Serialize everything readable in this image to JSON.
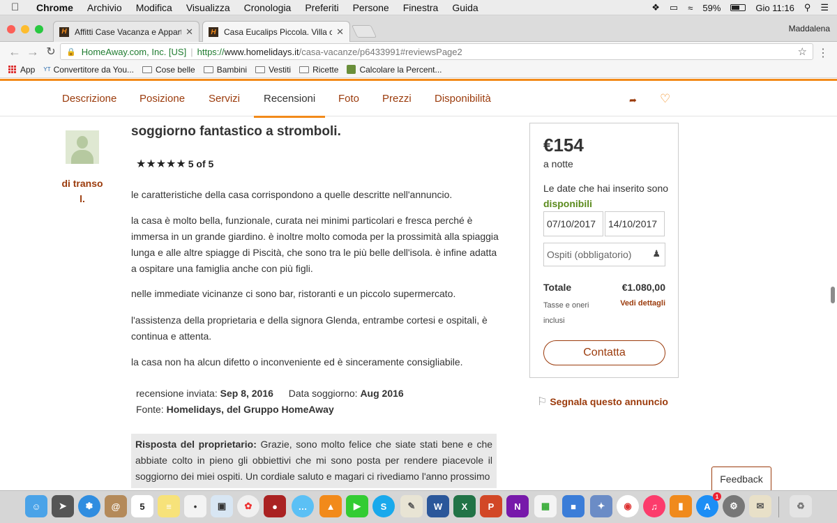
{
  "menubar": {
    "app": "Chrome",
    "items": [
      "Archivio",
      "Modifica",
      "Visualizza",
      "Cronologia",
      "Preferiti",
      "Persone",
      "Finestra",
      "Guida"
    ],
    "battery_percent": "59%",
    "battery_level": 0.59,
    "clock": "Gio 11:16"
  },
  "browser": {
    "tabs": [
      {
        "title": "Affitti Case Vacanza e Apparta"
      },
      {
        "title": "Casa Eucalips Piccola. Villa co"
      }
    ],
    "profile": "Maddalena",
    "address": {
      "secure_label": "HomeAway.com, Inc. [US]",
      "scheme": "https://",
      "host": "www.homelidays.it",
      "path": "/casa-vacanze/p6433991#reviewsPage2"
    },
    "bookmarks": [
      "App",
      "Convertitore da You...",
      "Cose belle",
      "Bambini",
      "Vestiti",
      "Ricette",
      "Calcolare la Percent..."
    ]
  },
  "page_nav": {
    "items": [
      "Descrizione",
      "Posizione",
      "Servizi",
      "Recensioni",
      "Foto",
      "Prezzi",
      "Disponibilità"
    ],
    "active": "Recensioni"
  },
  "review": {
    "reviewer": "di transo l.",
    "title": "soggiorno fantastico a stromboli.",
    "stars": "★★★★★",
    "rating": "5 of 5",
    "paragraphs": [
      "le caratteristiche della casa corrispondono a quelle descritte nell'annuncio.",
      "la casa è molto bella, funzionale, curata nei minimi particolari e fresca perché è immersa in un grande giardino. è inoltre molto comoda per la prossimità alla spiaggia lunga e alle altre spiagge di Piscità, che sono tra le più belle dell'isola. è infine adatta a ospitare una famiglia anche con più figli.",
      "nelle immediate vicinanze ci sono bar, ristoranti e un piccolo supermercato.",
      "l'assistenza della proprietaria e della signora Glenda, entrambe cortesi e ospitali, è continua e attenta.",
      "la casa non ha alcun difetto o inconveniente ed è sinceramente consigliabile."
    ],
    "sent_label": "recensione inviata:",
    "sent_date": "Sep 8, 2016",
    "stay_label": "Data soggiorno:",
    "stay_date": "Aug 2016",
    "source_label": "Fonte:",
    "source": "Homelidays, del Gruppo HomeAway",
    "owner_label": "Risposta del proprietario:",
    "owner_reply": "Grazie, sono molto felice che siate stati bene e che abbiate colto in pieno gli obbiettivi che mi sono posta per rendere piacevole il soggiorno dei miei ospiti. Un cordiale saluto e magari ci rivediamo l'anno prossimo"
  },
  "booking": {
    "price": "€154",
    "per_night": "a notte",
    "avail_text": "Le date che hai inserito sono",
    "avail_status": "disponibili",
    "checkin": "07/10/2017",
    "checkout": "14/10/2017",
    "guests_placeholder": "Ospiti (obbligatorio)",
    "total_label": "Totale",
    "total_value": "€1.080,00",
    "tax_note": "Tasse e oneri inclusi",
    "details_link": "Vedi dettagli",
    "contact_button": "Contatta"
  },
  "report_link": "Segnala questo annuncio",
  "feedback_button": "Feedback",
  "dock": {
    "calendar_day": "5",
    "appstore_badge": "1"
  },
  "colors": {
    "brand_orange": "#f28a1a",
    "link_brown": "#9b3b0c",
    "available_green": "#5a8a1c"
  }
}
